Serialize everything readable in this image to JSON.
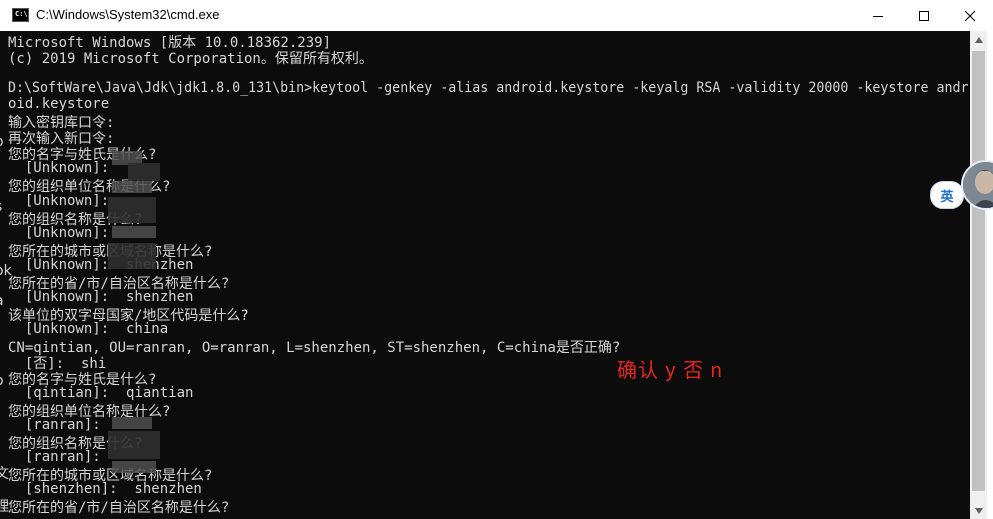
{
  "window": {
    "title": "C:\\Windows\\System32\\cmd.exe",
    "icon": "cmd-icon",
    "icon_text": "C:\\",
    "controls": [
      "minimize-icon",
      "maximize-icon",
      "close-icon"
    ]
  },
  "console": {
    "lines": [
      "Microsoft Windows [版本 10.0.18362.239]",
      "(c) 2019 Microsoft Corporation。保留所有权利。",
      "",
      "D:\\SoftWare\\Java\\Jdk\\jdk1.8.0_131\\bin>keytool -genkey -alias android.keystore -keyalg RSA -validity 20000 -keystore andr",
      "oid.keystore",
      "输入密钥库口令:",
      "再次输入新口令:",
      "您的名字与姓氏是什么?",
      "  [Unknown]:",
      "您的组织单位名称是什么?",
      "  [Unknown]:",
      "您的组织名称是什么?",
      "  [Unknown]:",
      "您所在的城市或区域名称是什么?",
      "  [Unknown]:  shenzhen",
      "您所在的省/市/自治区名称是什么?",
      "  [Unknown]:  shenzhen",
      "该单位的双字母国家/地区代码是什么?",
      "  [Unknown]:  china",
      "CN=qintian, OU=ranran, O=ranran, L=shenzhen, ST=shenzhen, C=china是否正确?",
      "  [否]:  shi",
      "您的名字与姓氏是什么?",
      "  [qintian]:  qiantian",
      "您的组织单位名称是什么?",
      "  [ranran]:",
      "您的组织名称是什么?",
      "  [ranran]:",
      "您所在的城市或区域名称是什么?",
      "  [shenzhen]:  shenzhen",
      "您所在的省/市/自治区名称是什么?"
    ],
    "text_color": "#d6d6d6",
    "background": "#0c0c0c"
  },
  "annotation": {
    "text": "确认 y 否 n",
    "color": "#e8251c"
  },
  "left_edge_chars": [
    "i",
    "o",
    "s",
    "ok",
    "a",
    "o",
    "文",
    "理"
  ],
  "ime_indicator": {
    "label": "英"
  }
}
